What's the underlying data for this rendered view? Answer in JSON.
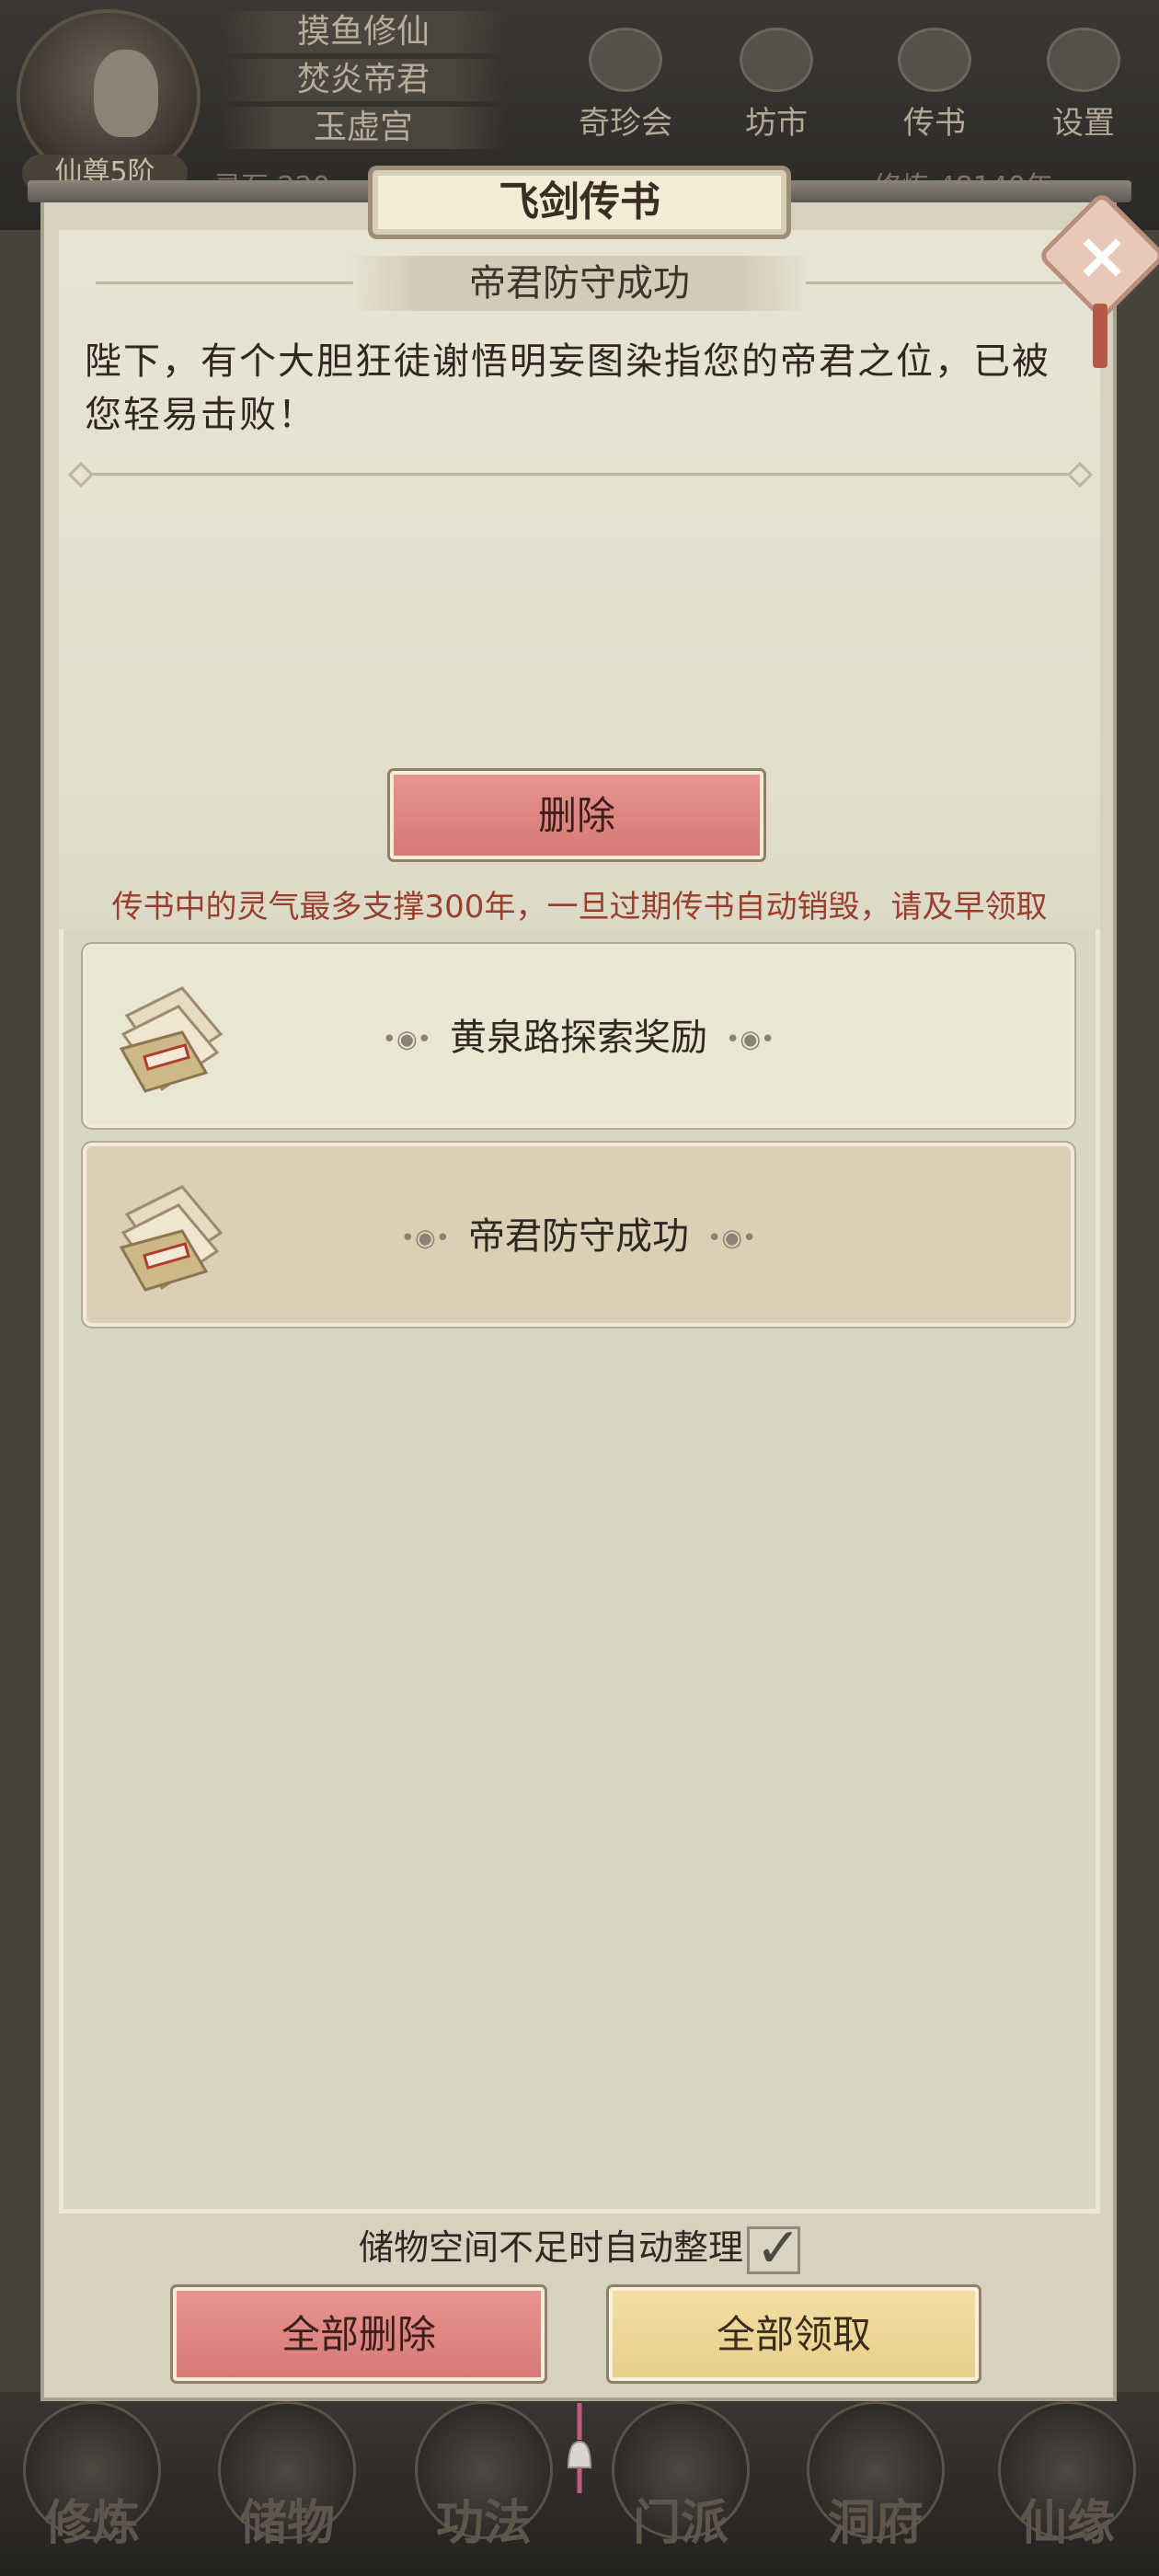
{
  "hud": {
    "names": [
      "摸鱼修仙",
      "焚炎帝君",
      "玉虚宫"
    ],
    "rank": "仙尊5阶",
    "stones_label": "灵石 220",
    "cultivation_label": "修炼 48140年",
    "buttons": [
      "奇珍会",
      "坊市",
      "传书",
      "设置"
    ]
  },
  "bottom_nav": [
    "修炼",
    "储物",
    "功法",
    "门派",
    "洞府",
    "仙缘"
  ],
  "dialog": {
    "title": "飞剑传书",
    "message": {
      "heading": "帝君防守成功",
      "body": "陛下，有个大胆狂徒谢悟明妄图染指您的帝君之位，已被您轻易击败！"
    },
    "delete_label": "删除",
    "notice": "传书中的灵气最多支撑300年，一旦过期传书自动销毁，请及早领取",
    "mails": [
      {
        "title": "黄泉路探索奖励",
        "state": "unread"
      },
      {
        "title": "帝君防守成功",
        "state": "read"
      }
    ],
    "auto_sort_label": "储物空间不足时自动整理",
    "auto_sort_checked": true,
    "delete_all_label": "全部删除",
    "claim_all_label": "全部领取"
  },
  "icons": {
    "close": "close-icon",
    "mail": "letter-scroll-icon",
    "checkbox": "checkmark-icon"
  },
  "colors": {
    "delete_button": "#d67a76",
    "claim_button": "#e9cf8c",
    "notice_text": "#9a3e2d"
  }
}
